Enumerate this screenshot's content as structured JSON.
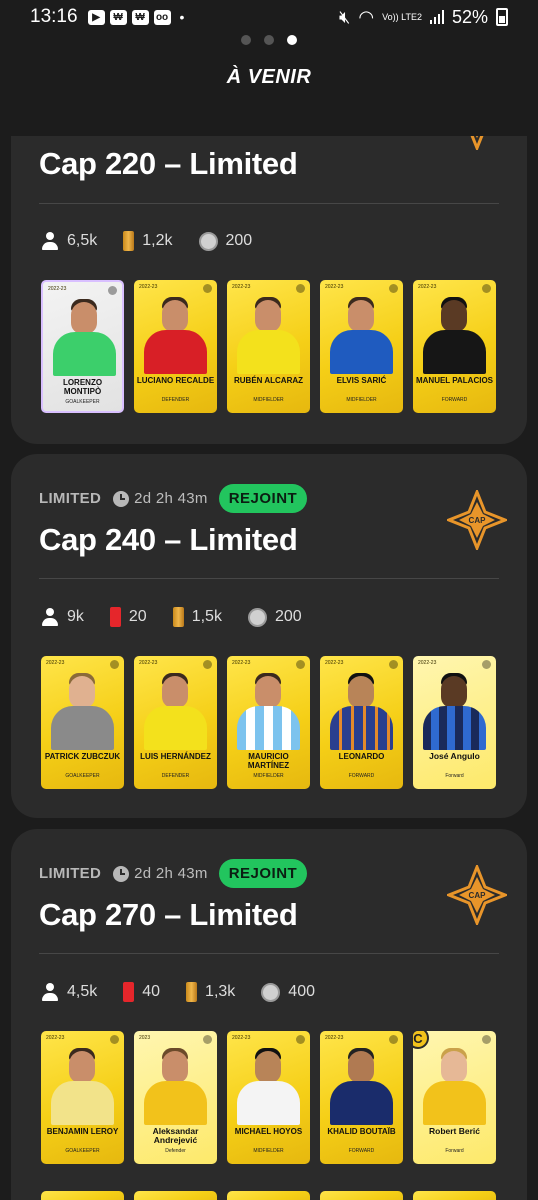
{
  "status_bar": {
    "time": "13:16",
    "notification_icons": [
      "youtube-icon",
      "won-icon",
      "won-icon",
      "voicemail-icon"
    ],
    "dot": "•",
    "lte_label": "Vo)) LTE2",
    "battery": "52%"
  },
  "header": {
    "page_dots": 3,
    "active_dot": 3,
    "title": "À VENIR"
  },
  "competitions": [
    {
      "title": "Cap 220 – Limited",
      "stats": {
        "users": "6,5k",
        "limited_cards": "1,2k",
        "coins": "200"
      },
      "players": [
        {
          "name": "LORENZO MONTIPÒ",
          "position": "GOALKEEPER",
          "rarity": "common"
        },
        {
          "name": "LUCIANO RECALDE",
          "position": "DEFENDER",
          "rarity": "limited"
        },
        {
          "name": "RUBÉN ALCARAZ",
          "position": "MIDFIELDER",
          "rarity": "limited"
        },
        {
          "name": "ELVIS SARIĆ",
          "position": "MIDFIELDER",
          "rarity": "limited"
        },
        {
          "name": "MANUEL PALACIOS",
          "position": "FORWARD",
          "rarity": "limited"
        }
      ]
    },
    {
      "status": "LIMITED",
      "time_left": "2d 2h 43m",
      "badge": "REJOINT",
      "title": "Cap 240 – Limited",
      "stats": {
        "users": "9k",
        "rare_cards": "20",
        "limited_cards": "1,5k",
        "coins": "200"
      },
      "players": [
        {
          "name": "PATRICK ZUBCZUK",
          "position": "GOALKEEPER",
          "rarity": "limited"
        },
        {
          "name": "LUIS HERNÁNDEZ",
          "position": "DEFENDER",
          "rarity": "limited"
        },
        {
          "name": "MAURICIO MARTÍNEZ",
          "position": "MIDFIELDER",
          "rarity": "limited"
        },
        {
          "name": "LEONARDO",
          "position": "FORWARD",
          "rarity": "limited"
        },
        {
          "name": "José Angulo",
          "position": "Forward",
          "rarity": "limited-new"
        }
      ]
    },
    {
      "status": "LIMITED",
      "time_left": "2d 2h 43m",
      "badge": "REJOINT",
      "title": "Cap 270 – Limited",
      "stats": {
        "users": "4,5k",
        "rare_cards": "40",
        "limited_cards": "1,3k",
        "coins": "400"
      },
      "players": [
        {
          "name": "BENJAMIN LEROY",
          "position": "GOALKEEPER",
          "rarity": "limited"
        },
        {
          "name": "Aleksandar Andrejević",
          "position": "Defender",
          "rarity": "limited-new"
        },
        {
          "name": "MICHAEL HOYOS",
          "position": "MIDFIELDER",
          "rarity": "limited"
        },
        {
          "name": "KHALID BOUTAÏB",
          "position": "FORWARD",
          "rarity": "limited"
        },
        {
          "name": "Robert Berić",
          "position": "Forward",
          "rarity": "limited-new",
          "captain": "C"
        }
      ]
    }
  ],
  "colors": {
    "background": "#1c1c1c",
    "card": "#2b2b2b",
    "badge": "#22c55e",
    "cap_logo": "#e8952a"
  }
}
